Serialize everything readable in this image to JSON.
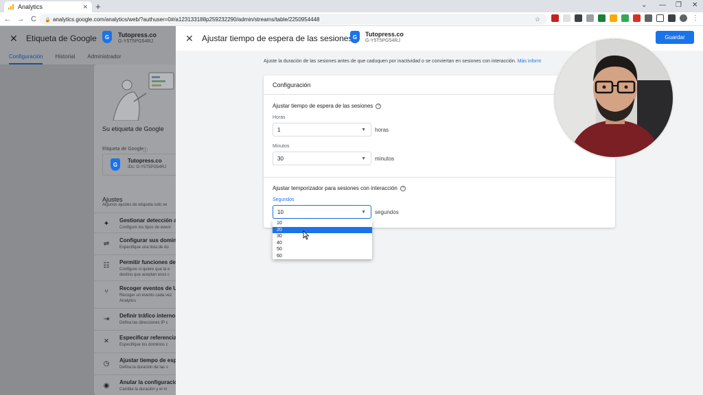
{
  "browser": {
    "tab_title": "Analytics",
    "tab_close": "✕",
    "new_tab": "+",
    "url": "analytics.google.com/analytics/web/?authuser=0#/a123133188p259232290/admin/streams/table/2250954448",
    "nav_back": "←",
    "nav_forward": "→",
    "nav_reload": "C",
    "win_minimize": "—",
    "win_maximize": "❐",
    "win_close": "✕",
    "win_tabsearch": "⌄"
  },
  "background_page": {
    "title": "Etiqueta de Google",
    "tag_name": "Tutopress.co",
    "tag_id": "G-Y5T5PG54RJ",
    "tabs": [
      "Configuración",
      "Historial",
      "Administrador"
    ],
    "tag_card_title": "Su etiqueta de Google",
    "tag_card_label": "Etiqueta de Google",
    "tag_card_name": "Tutopress.co",
    "tag_card_id": "IDs: G-Y5T5PG54RJ",
    "settings_title": "Ajustes",
    "settings_subtitle": "Algunos ajustes de etiqueta solo se",
    "settings": [
      {
        "title": "Gestionar detección au",
        "desc": "Configure los tipos de event"
      },
      {
        "title": "Configurar sus dominio",
        "desc": "Especifique una lista de do"
      },
      {
        "title": "Permitir funciones de d",
        "desc": "Configure si quiere que la e destino que aceptan esos c"
      },
      {
        "title": "Recoger eventos de Uni",
        "desc": "Recoger un evento cada vez Analytics"
      },
      {
        "title": "Definir tráfico interno",
        "desc": "Defina las direcciones IP c"
      },
      {
        "title": "Especificar referencias",
        "desc": "Especifique los dominios c"
      },
      {
        "title": "Ajustar tiempo de espe",
        "desc": "Defina la duración de las s"
      },
      {
        "title": "Anular la configuración",
        "desc": "Cambie la duración y el m"
      }
    ]
  },
  "panel": {
    "title": "Ajustar tiempo de espera de las sesiones",
    "tag_name": "Tutopress.co",
    "tag_id": "G-Y5T5PG54RJ",
    "save_label": "Guardar",
    "intro_text": "Ajuste la duración de las sesiones antes de que caduquen por inactividad o se conviertan en sesiones con interacción.",
    "intro_link": "Más inform",
    "card_title": "Configuración",
    "timeout_section_title": "Ajustar tiempo de espera de las sesiones",
    "hours_label": "Horas",
    "hours_value": "1",
    "hours_unit": "horas",
    "minutes_label": "Minutos",
    "minutes_value": "30",
    "minutes_unit": "minutos",
    "engaged_section_title": "Ajustar temporizador para sesiones con interacción",
    "seconds_label": "Segundos",
    "seconds_value": "10",
    "seconds_unit": "segundos",
    "seconds_options": [
      "10",
      "20",
      "30",
      "40",
      "50",
      "60"
    ],
    "highlighted_option": "20"
  },
  "colors": {
    "accent": "#1a73e8",
    "dim_overlay": "#8a8c8f",
    "panel_bg": "#f1f3f4"
  }
}
